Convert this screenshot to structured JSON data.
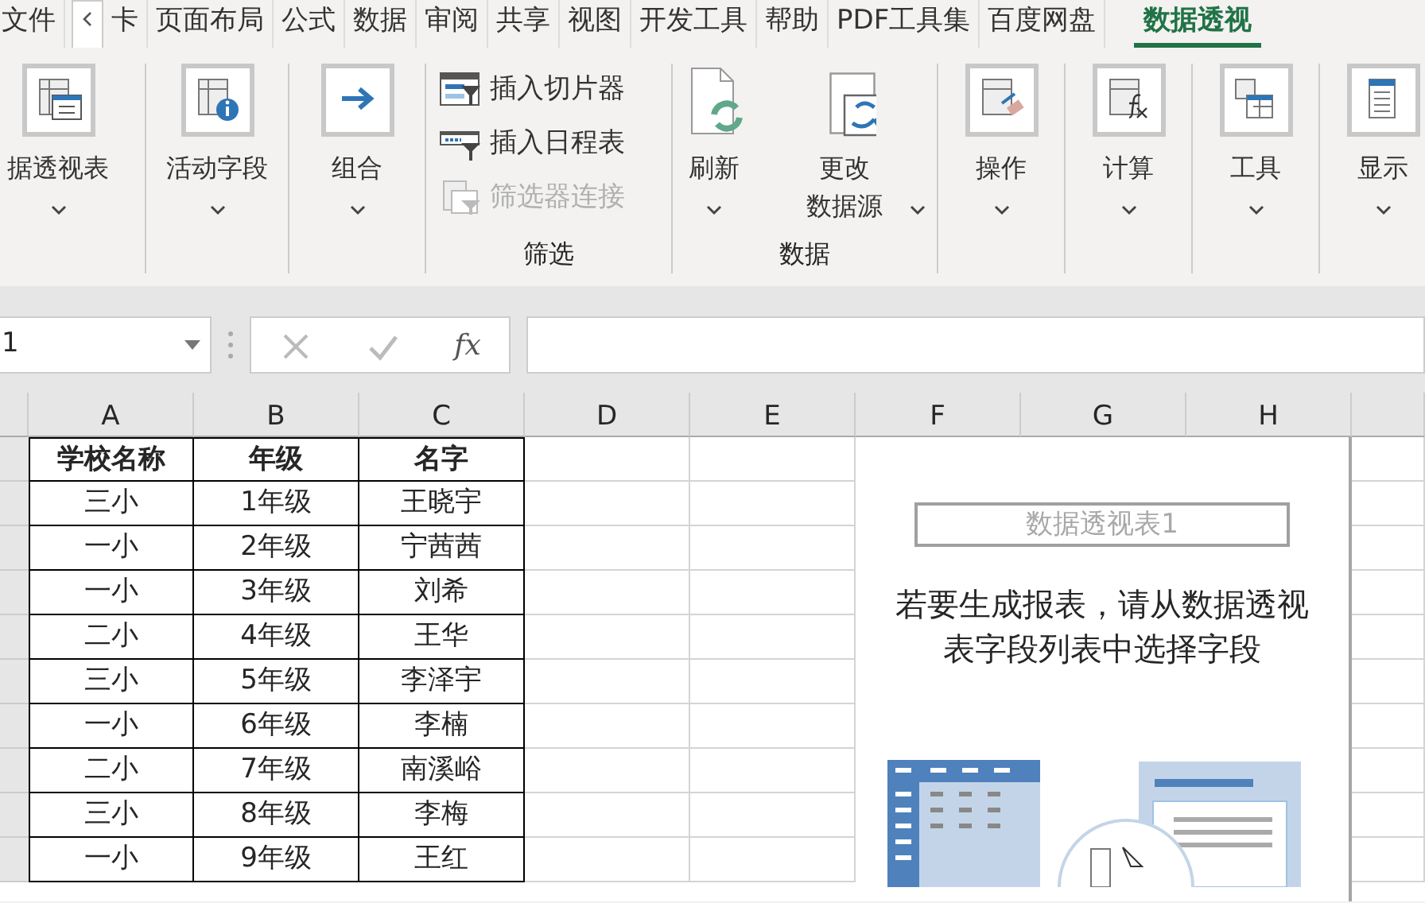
{
  "tabs": [
    {
      "label": "文件",
      "selected": false
    },
    {
      "label": "卡",
      "selected": false
    },
    {
      "label": "页面布局",
      "selected": false
    },
    {
      "label": "公式",
      "selected": false
    },
    {
      "label": "数据",
      "selected": false
    },
    {
      "label": "审阅",
      "selected": false
    },
    {
      "label": "共享",
      "selected": false
    },
    {
      "label": "视图",
      "selected": false
    },
    {
      "label": "开发工具",
      "selected": false
    },
    {
      "label": "帮助",
      "selected": false
    },
    {
      "label": "PDF工具集",
      "selected": false
    },
    {
      "label": "百度网盘",
      "selected": false
    },
    {
      "label": "数据透视",
      "selected": true
    }
  ],
  "ribbon_groups": [
    {
      "buttons": [
        {
          "kind": "large",
          "lines": [
            "据透视表"
          ],
          "dropdown": true,
          "disabled": false
        }
      ]
    },
    {
      "buttons": [
        {
          "kind": "large",
          "lines": [
            "活动字段"
          ],
          "dropdown": true,
          "disabled": false
        }
      ]
    },
    {
      "buttons": [
        {
          "kind": "large",
          "lines": [
            "组合"
          ],
          "dropdown": true,
          "disabled": false
        }
      ]
    },
    {
      "label": "筛选",
      "buttons": [
        {
          "kind": "small",
          "lines": [
            "插入切片器"
          ],
          "dropdown": false,
          "disabled": false
        },
        {
          "kind": "small",
          "lines": [
            "插入日程表"
          ],
          "dropdown": false,
          "disabled": false
        },
        {
          "kind": "small",
          "lines": [
            "筛选器连接"
          ],
          "dropdown": false,
          "disabled": true
        }
      ]
    },
    {
      "label": "数据",
      "buttons": [
        {
          "kind": "doc",
          "lines": [
            "刷新"
          ],
          "dropdown": true,
          "disabled": false
        },
        {
          "kind": "doc",
          "lines": [
            "更改",
            "数据源"
          ],
          "dropdown": true,
          "disabled": false
        }
      ]
    },
    {
      "buttons": [
        {
          "kind": "large",
          "lines": [
            "操作"
          ],
          "dropdown": true,
          "disabled": false
        }
      ]
    },
    {
      "buttons": [
        {
          "kind": "large",
          "lines": [
            "计算"
          ],
          "dropdown": true,
          "disabled": false
        }
      ]
    },
    {
      "buttons": [
        {
          "kind": "large",
          "lines": [
            "工具"
          ],
          "dropdown": true,
          "disabled": false
        }
      ]
    },
    {
      "buttons": [
        {
          "kind": "large",
          "lines": [
            "显示"
          ],
          "dropdown": true,
          "disabled": false
        }
      ]
    }
  ],
  "formula_bar": {
    "name_box": "1",
    "function_label": "fx"
  },
  "sheet": {
    "columns": [
      "A",
      "B",
      "C",
      "D",
      "E",
      "F",
      "G",
      "H"
    ],
    "rows": [
      {
        "header": true,
        "cells": [
          "学校名称",
          "年级",
          "名字"
        ]
      },
      {
        "header": false,
        "cells": [
          "三小",
          "1年级",
          "王晓宇"
        ]
      },
      {
        "header": false,
        "cells": [
          "一小",
          "2年级",
          "宁茜茜"
        ]
      },
      {
        "header": false,
        "cells": [
          "一小",
          "3年级",
          "刘希"
        ]
      },
      {
        "header": false,
        "cells": [
          "二小",
          "4年级",
          "王华"
        ]
      },
      {
        "header": false,
        "cells": [
          "三小",
          "5年级",
          "李泽宇"
        ]
      },
      {
        "header": false,
        "cells": [
          "一小",
          "6年级",
          "李楠"
        ]
      },
      {
        "header": false,
        "cells": [
          "二小",
          "7年级",
          "南溪峪"
        ]
      },
      {
        "header": false,
        "cells": [
          "三小",
          "8年级",
          "李梅"
        ]
      },
      {
        "header": false,
        "cells": [
          "一小",
          "9年级",
          "王红"
        ]
      }
    ]
  },
  "pivot_placeholder": {
    "title": "数据透视表1",
    "hint": "若要生成报表，请从数据透视表字段列表中选择字段"
  }
}
